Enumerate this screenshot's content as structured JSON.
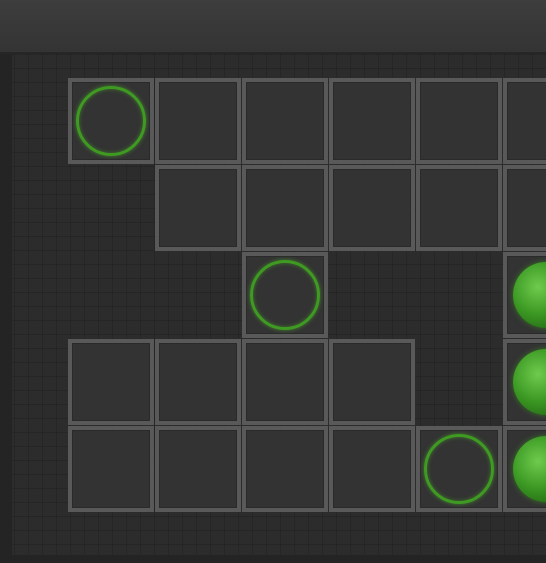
{
  "colors": {
    "background": "#2c2c2c",
    "cell_fill": "#333333",
    "cell_border": "#595959",
    "target_ring": "#3f9a22",
    "orb": "#3d9a24"
  },
  "grid": {
    "columns_visible": 6,
    "rows": 5,
    "cells": [
      {
        "row": 0,
        "col": 0,
        "content": "target-ring"
      },
      {
        "row": 0,
        "col": 1,
        "content": "empty"
      },
      {
        "row": 0,
        "col": 2,
        "content": "empty"
      },
      {
        "row": 0,
        "col": 3,
        "content": "empty"
      },
      {
        "row": 0,
        "col": 4,
        "content": "empty"
      },
      {
        "row": 0,
        "col": 5,
        "content": "empty"
      },
      {
        "row": 1,
        "col": 1,
        "content": "empty"
      },
      {
        "row": 1,
        "col": 2,
        "content": "empty"
      },
      {
        "row": 1,
        "col": 3,
        "content": "empty"
      },
      {
        "row": 1,
        "col": 4,
        "content": "empty"
      },
      {
        "row": 1,
        "col": 5,
        "content": "empty"
      },
      {
        "row": 2,
        "col": 2,
        "content": "target-ring"
      },
      {
        "row": 2,
        "col": 5,
        "content": "green-orb"
      },
      {
        "row": 3,
        "col": 0,
        "content": "empty"
      },
      {
        "row": 3,
        "col": 1,
        "content": "empty"
      },
      {
        "row": 3,
        "col": 2,
        "content": "empty"
      },
      {
        "row": 3,
        "col": 3,
        "content": "empty"
      },
      {
        "row": 3,
        "col": 5,
        "content": "green-orb"
      },
      {
        "row": 4,
        "col": 0,
        "content": "empty"
      },
      {
        "row": 4,
        "col": 1,
        "content": "empty"
      },
      {
        "row": 4,
        "col": 2,
        "content": "empty"
      },
      {
        "row": 4,
        "col": 3,
        "content": "empty"
      },
      {
        "row": 4,
        "col": 4,
        "content": "target-ring"
      },
      {
        "row": 4,
        "col": 5,
        "content": "green-orb"
      }
    ]
  }
}
